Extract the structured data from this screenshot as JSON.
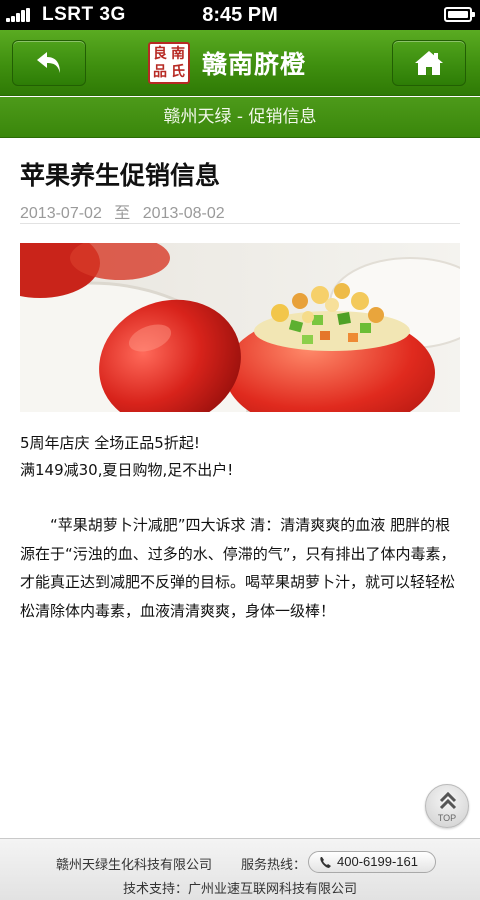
{
  "status_bar": {
    "carrier": "LSRT 3G",
    "time": "8:45 PM"
  },
  "header": {
    "brand_name": "赣南脐橙",
    "logo_chars": [
      "良",
      "南",
      "品",
      "氏"
    ],
    "sub_title": "赣州天绿 - 促销信息"
  },
  "article": {
    "title": "苹果养生促销信息",
    "date_start": "2013-07-02",
    "date_sep": "至",
    "date_end": "2013-08-02",
    "promo_line1": "5周年店庆 全场正品5折起!",
    "promo_line2": "满149减30,夏日购物,足不出户!",
    "body": "“苹果胡萝卜汁减肥”四大诉求  清：清清爽爽的血液 肥胖的根源在于“污浊的血、过多的水、停滞的气”，只有排出了体内毒素，才能真正达到减肥不反弹的目标。喝苹果胡萝卜汁，就可以轻轻松松清除体内毒素，血液清清爽爽，身体一级棒！"
  },
  "top_button": {
    "label": "TOP"
  },
  "footer": {
    "company": "赣州天绿生化科技有限公司",
    "hotline_label": "服务热线：",
    "phone": "400-6199-161",
    "support": "技术支持：广州业速互联网科技有限公司"
  },
  "colors": {
    "header_green": "#3f8f0f",
    "brand_red": "#b72a24"
  }
}
